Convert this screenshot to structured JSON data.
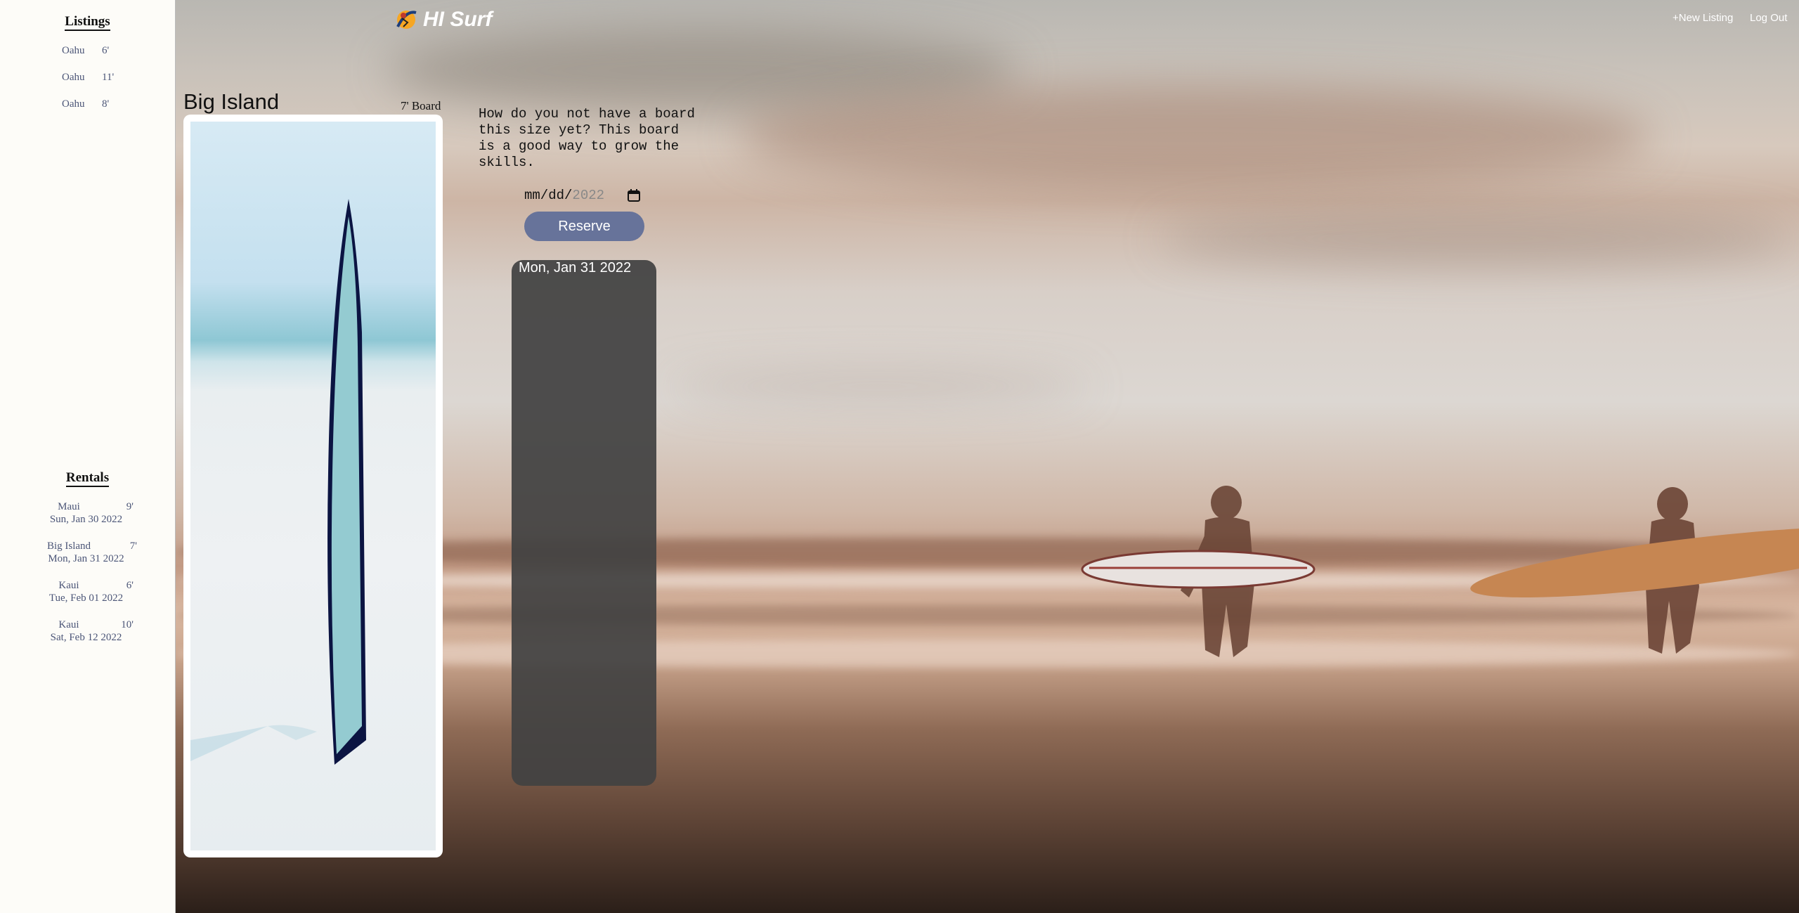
{
  "app": {
    "brand_name": "HI Surf"
  },
  "nav": {
    "new_listing": "+New Listing",
    "log_out": "Log Out"
  },
  "sidebar": {
    "listings_title": "Listings",
    "listings": [
      {
        "location": "Oahu",
        "size": "6'"
      },
      {
        "location": "Oahu",
        "size": "11'"
      },
      {
        "location": "Oahu",
        "size": "8'"
      }
    ],
    "rentals_title": "Rentals",
    "rentals": [
      {
        "location": "Maui",
        "size": "9'",
        "date": "Sun, Jan 30 2022"
      },
      {
        "location": "Big Island",
        "size": "7'",
        "date": "Mon, Jan 31 2022"
      },
      {
        "location": "Kaui",
        "size": "6'",
        "date": "Tue, Feb 01 2022"
      },
      {
        "location": "Kaui",
        "size": "10'",
        "date": "Sat, Feb 12 2022"
      }
    ]
  },
  "listing": {
    "location": "Big Island",
    "size_label": "7' Board",
    "description": "How do you not have a board\nthis size yet? This board\nis a good way to grow the\nskills.",
    "date_input": {
      "placeholder_mmdd": "mm/dd/",
      "placeholder_year": "2022"
    },
    "reserve_label": "Reserve",
    "booked_dates": [
      "Mon, Jan 31 2022"
    ]
  },
  "icons": {
    "logo": "surfer-logo-icon",
    "calendar": "calendar-icon"
  },
  "colors": {
    "reserve_button": "#67739a",
    "sidebar_bg": "#fdfcf8",
    "link": "#4b5577",
    "booked_panel": "#424242"
  }
}
